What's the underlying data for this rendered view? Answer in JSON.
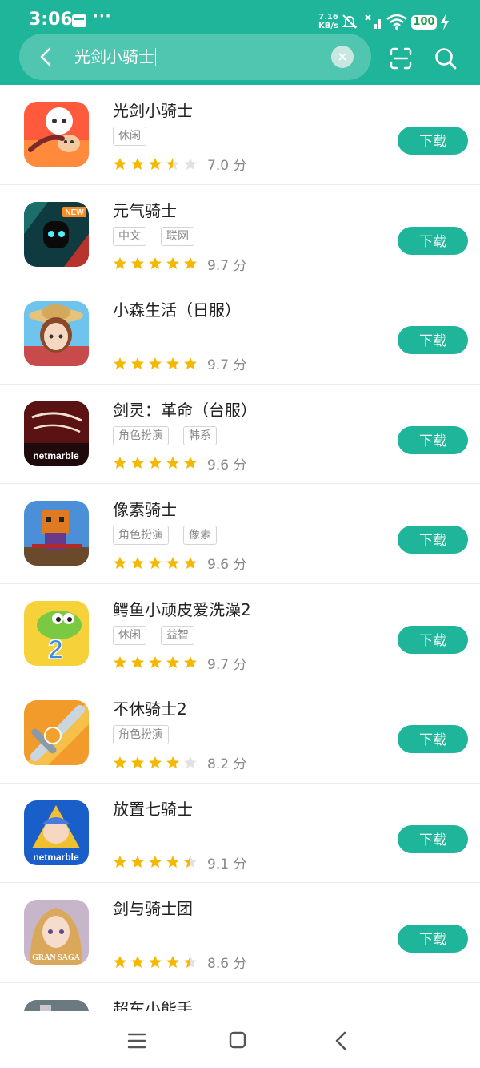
{
  "status_bar": {
    "time": "3:06",
    "more": "···",
    "net_speed_value": "7.16",
    "net_speed_unit": "KB/s",
    "battery": "100"
  },
  "search": {
    "query": "光剑小骑士"
  },
  "colors": {
    "accent": "#1fb59a",
    "star": "#f5b800",
    "star_empty": "#e2e2e2"
  },
  "apps": [
    {
      "name": "光剑小骑士",
      "tags": [
        "休闲"
      ],
      "stars": 3.5,
      "score": "7.0 分",
      "button": "下载",
      "icon": "app-icon-lightsaber-knight"
    },
    {
      "name": "元气骑士",
      "tags": [
        "中文",
        "联网"
      ],
      "stars": 5,
      "score": "9.7 分",
      "button": "下载",
      "icon": "app-icon-soul-knight",
      "badge": "NEW"
    },
    {
      "name": "小森生活（日服）",
      "tags": [],
      "stars": 5,
      "score": "9.7 分",
      "button": "下载",
      "icon": "app-icon-forest-life"
    },
    {
      "name": "剑灵：革命（台服）",
      "tags": [
        "角色扮演",
        "韩系"
      ],
      "stars": 5,
      "score": "9.6 分",
      "button": "下载",
      "icon": "app-icon-blade-soul-revolution",
      "logo_text": "netmarble"
    },
    {
      "name": "像素骑士",
      "tags": [
        "角色扮演",
        "像素"
      ],
      "stars": 5,
      "score": "9.6 分",
      "button": "下载",
      "icon": "app-icon-pixel-knight"
    },
    {
      "name": "鳄鱼小顽皮爱洗澡2",
      "tags": [
        "休闲",
        "益智"
      ],
      "stars": 5,
      "score": "9.7 分",
      "button": "下载",
      "icon": "app-icon-wheres-my-water-2"
    },
    {
      "name": "不休骑士2",
      "tags": [
        "角色扮演"
      ],
      "stars": 4,
      "score": "8.2 分",
      "button": "下载",
      "icon": "app-icon-tap-knight-2"
    },
    {
      "name": "放置七骑士",
      "tags": [],
      "stars": 4.5,
      "score": "9.1 分",
      "button": "下载",
      "icon": "app-icon-seven-knights-idle",
      "logo_text": "netmarble"
    },
    {
      "name": "剑与骑士团",
      "tags": [],
      "stars": 4.5,
      "score": "8.6 分",
      "button": "下载",
      "icon": "app-icon-gran-saga",
      "logo_text": "GRAN SAGA"
    },
    {
      "name": "超车小能手",
      "tags": [],
      "stars": 0,
      "score": "",
      "button": "",
      "icon": "app-icon-overtake"
    }
  ]
}
